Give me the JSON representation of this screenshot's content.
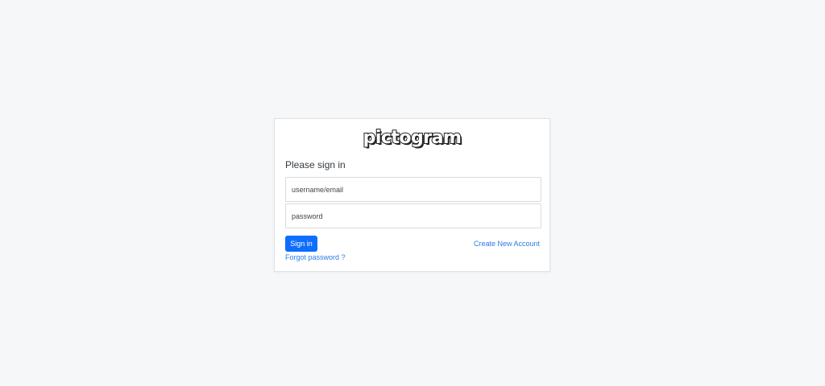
{
  "brand": {
    "logo_text": "pictogram"
  },
  "login": {
    "heading": "Please sign in",
    "username_placeholder": "username/email",
    "password_placeholder": "password",
    "signin_label": "Sign in",
    "create_account_label": "Create New Account",
    "forgot_password_label": "Forgot password ?"
  },
  "colors": {
    "background": "#f5f7f9",
    "primary": "#0d6efd",
    "link": "#2c7be5"
  }
}
